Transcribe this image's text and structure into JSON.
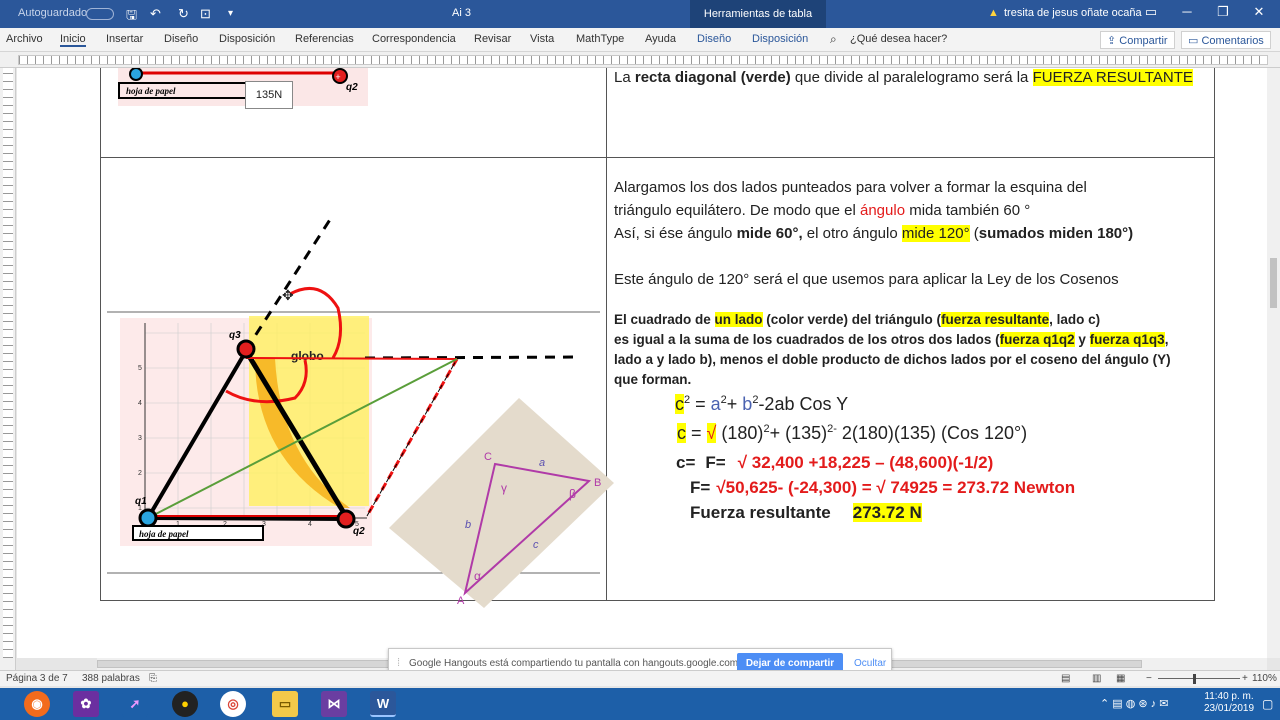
{
  "titlebar": {
    "autosave": "Autoguardado",
    "doc_title": "Ai 3",
    "context_tab": "Herramientas de tabla",
    "user": "tresita de jesus oñate ocaña"
  },
  "ribbon": {
    "tabs": [
      "Archivo",
      "Inicio",
      "Insertar",
      "Diseño",
      "Disposición",
      "Referencias",
      "Correspondencia",
      "Revisar",
      "Vista",
      "MathType",
      "Ayuda"
    ],
    "context_tabs": [
      "Diseño",
      "Disposición"
    ],
    "search_placeholder": "¿Qué desea hacer?",
    "share": "Compartir",
    "comments": "Comentarios"
  },
  "figure_top": {
    "label_q2": "q2",
    "paper_label": "hoja de papel",
    "force_box": "135N"
  },
  "figure_main": {
    "label_q1": "q1",
    "label_q2": "q2",
    "label_q3": "q3",
    "label_globo": "globo",
    "paper_label": "hoja de papel",
    "grid_ticks_x": [
      "1",
      "2",
      "3",
      "4",
      "5"
    ],
    "grid_ticks_y": [
      "1",
      "2",
      "3",
      "4",
      "5"
    ]
  },
  "triangle_card": {
    "vertex_a": "A",
    "vertex_b": "B",
    "vertex_c": "C",
    "side_a": "a",
    "side_b": "b",
    "side_c": "c",
    "angle_alpha": "α",
    "angle_beta": "β",
    "angle_gamma": "γ"
  },
  "content": {
    "row1_line": {
      "pre": "La ",
      "bold": "recta diagonal (verde)",
      "mid": " que divide al paralelogramo será la ",
      "hl": "FUERZA RESULTANTE"
    },
    "p1": "Alargamos los dos lados punteados para volver a formar la esquina del",
    "p2_pre": "triángulo equilátero. De modo que el ",
    "p2_red": "ángulo",
    "p2_post": " mida también 60 °",
    "p3_pre": "Así, si ése ángulo ",
    "p3_b1": "mide 60°,",
    "p3_mid": " el otro ángulo ",
    "p3_hl": "mide 120°",
    "p3_b2_pre": " (",
    "p3_b2": "sumados miden 180°)",
    "p4": "Este ángulo de 120° será el que usemos para aplicar la Ley de los Cosenos",
    "b1_pre": "El cuadrado de ",
    "b1_hl1": "un lado",
    "b1_mid": "  (color verde) del triángulo (",
    "b1_hl2": "fuerza resultante",
    "b1_post": ", lado c)",
    "b2_pre": "es igual a la suma de los cuadrados de los otros dos lados (",
    "b2_hl1": "fuerza q1q2",
    "b2_mid": " y ",
    "b2_hl2": "fuerza q1q3",
    "b2_post": ",",
    "b3": "lado a y lado b), menos el doble producto de dichos lados por el coseno del ángulo (Y)",
    "b4": "que forman.",
    "eq1": {
      "c": "c",
      "rest1": " = ",
      "a": "a",
      "plus": "+ ",
      "b": "b",
      "tail": "-2ab Cos Y"
    },
    "eq2": {
      "c": "c",
      "eq": " = ",
      "root": "√",
      "rest": " (180)",
      "p1": "2",
      "mid": "+ (135)",
      "p2": "2-",
      "tail": " 2(180)(135) (Cos 120°)"
    },
    "eq3": {
      "c": "c=",
      "f": "F=",
      "expr": "√ 32,400 +18,225 – (48,600)(-1/2)"
    },
    "eq4": {
      "f": "F=",
      "expr": "√50,625- (-24,300)   = √ 74925   = 273.72 Newton"
    },
    "eq5": {
      "label": "Fuerza resultante",
      "value": "273.72 N"
    }
  },
  "hangouts": {
    "message": "Google Hangouts está compartiendo tu pantalla con hangouts.google.com.",
    "stop": "Dejar de compartir",
    "hide": "Ocultar"
  },
  "status": {
    "page": "Página 3 de 7",
    "words": "388 palabras",
    "zoom": "110%"
  },
  "clock": {
    "time": "11:40 p. m.",
    "date": "23/01/2019"
  },
  "colors": {
    "word_blue": "#2b579a",
    "highlight": "#ffff00",
    "red": "#e31b1b",
    "green_line": "#5a9e3a"
  }
}
